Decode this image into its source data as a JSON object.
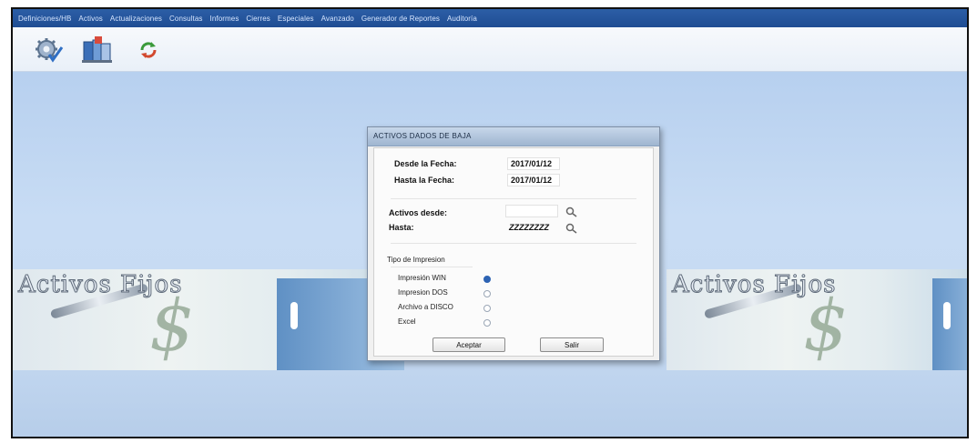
{
  "menu": {
    "items": [
      "Definiciones/HB",
      "Activos",
      "Actualizaciones",
      "Consultas",
      "Informes",
      "Cierres",
      "Especiales",
      "Avanzado",
      "Generador de Reportes",
      "Auditoría"
    ]
  },
  "toolbar": {
    "icons": [
      "gear-check-icon",
      "books-icon",
      "refresh-icon"
    ]
  },
  "background": {
    "banner_title": "Activos Fijos",
    "dollar_symbol": "$"
  },
  "dialog": {
    "title": "ACTIVOS DADOS DE BAJA",
    "desde_fecha_label": "Desde la Fecha:",
    "desde_fecha_value": "2017/01/12",
    "hasta_fecha_label": "Hasta la Fecha:",
    "hasta_fecha_value": "2017/01/12",
    "activos_desde_label": "Activos desde:",
    "activos_desde_value": "",
    "hasta_label": "Hasta:",
    "hasta_value": "ZZZZZZZZ",
    "tipo_label": "Tipo de Impresion",
    "options": [
      "Impresión WIN",
      "Impresion DOS",
      "Archivo a DISCO",
      "Excel"
    ],
    "selected_option": "Impresión WIN",
    "accept_label": "Aceptar",
    "exit_label": "Salir"
  },
  "colors": {
    "menubar": "#1f4d93",
    "desktop": "#c8dcf4",
    "dialog_title": "#9fb5d0",
    "radio_selected": "#2d63b3"
  }
}
